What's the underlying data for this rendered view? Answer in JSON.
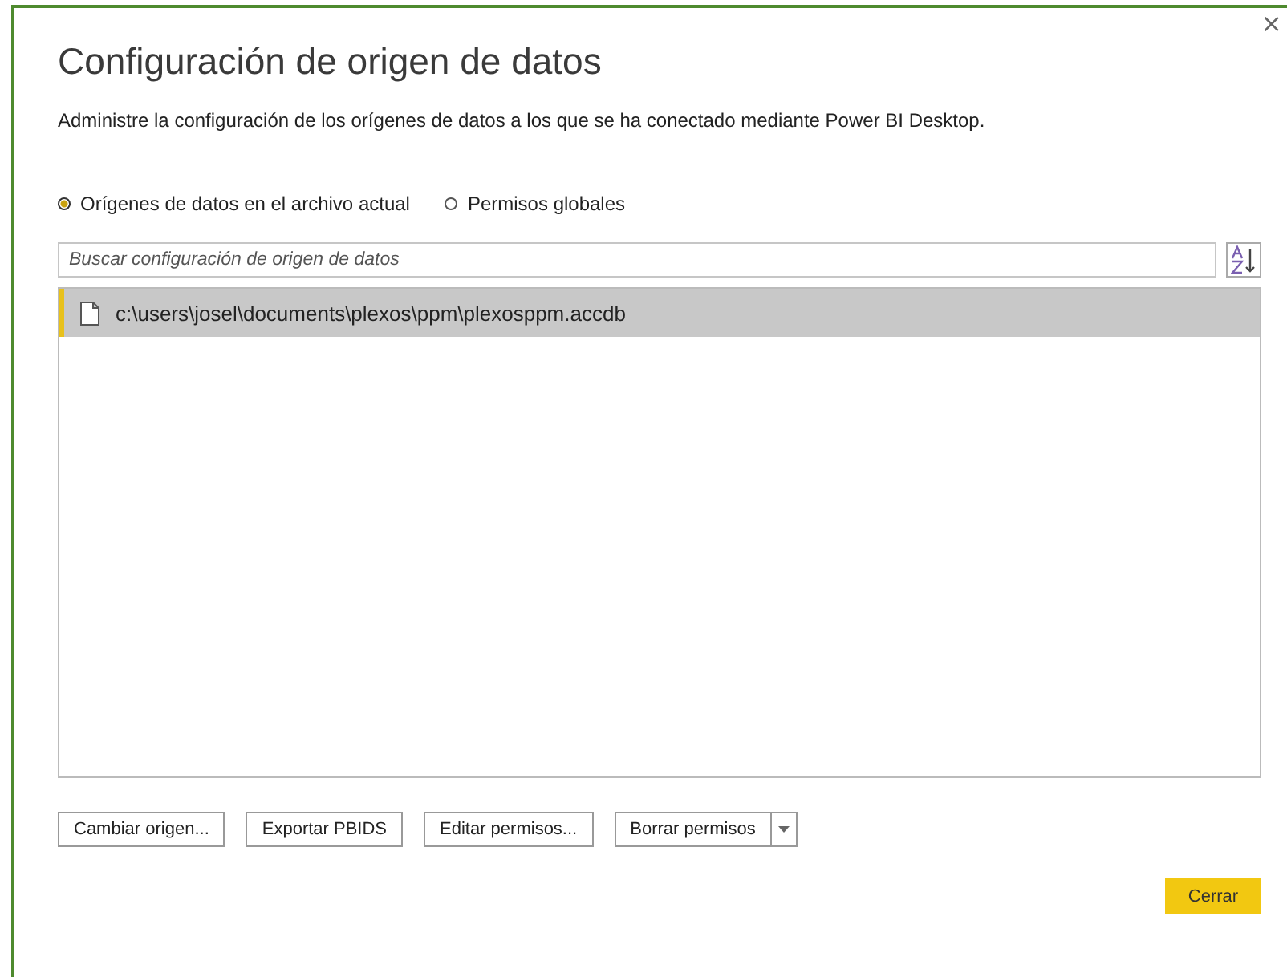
{
  "dialog": {
    "title": "Configuración de origen de datos",
    "close": "×",
    "description": "Administre la configuración de los orígenes de datos a los que se ha conectado mediante Power BI Desktop."
  },
  "scope_options": [
    {
      "label": "Orígenes de datos en el archivo actual",
      "selected": true
    },
    {
      "label": "Permisos globales",
      "selected": false
    }
  ],
  "search": {
    "placeholder": "Buscar configuración de origen de datos"
  },
  "sources": [
    {
      "path": "c:\\users\\josel\\documents\\plexos\\ppm\\plexosppm.accdb",
      "selected": true
    }
  ],
  "buttons": [
    {
      "label": "Cambiar origen...",
      "kind": "plain"
    },
    {
      "label": "Exportar PBIDS",
      "kind": "plain"
    },
    {
      "label": "Editar permisos...",
      "kind": "plain"
    },
    {
      "label": "Borrar permisos",
      "kind": "split"
    }
  ],
  "close_button": "Cerrar"
}
